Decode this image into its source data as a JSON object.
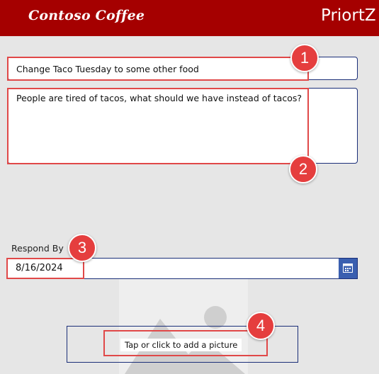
{
  "header": {
    "logo_text": "Contoso Coffee",
    "app_title": "PriortZ A",
    "background_color": "#a50000"
  },
  "form": {
    "title_value": "Change Taco Tuesday to some other food",
    "description_value": "People are tired of tacos, what should we have instead of tacos?",
    "respond_by_label": "Respond By",
    "respond_by_value": "8/16/2024",
    "picture_button_label": "Tap or click to add a picture",
    "border_color": "#1a2e78"
  },
  "icons": {
    "calendar": "calendar-icon",
    "image_placeholder": "add-picture-icon"
  },
  "callouts": [
    {
      "number": "1",
      "color": "#e53e3e"
    },
    {
      "number": "2",
      "color": "#e53e3e"
    },
    {
      "number": "3",
      "color": "#e53e3e"
    },
    {
      "number": "4",
      "color": "#e53e3e"
    }
  ]
}
